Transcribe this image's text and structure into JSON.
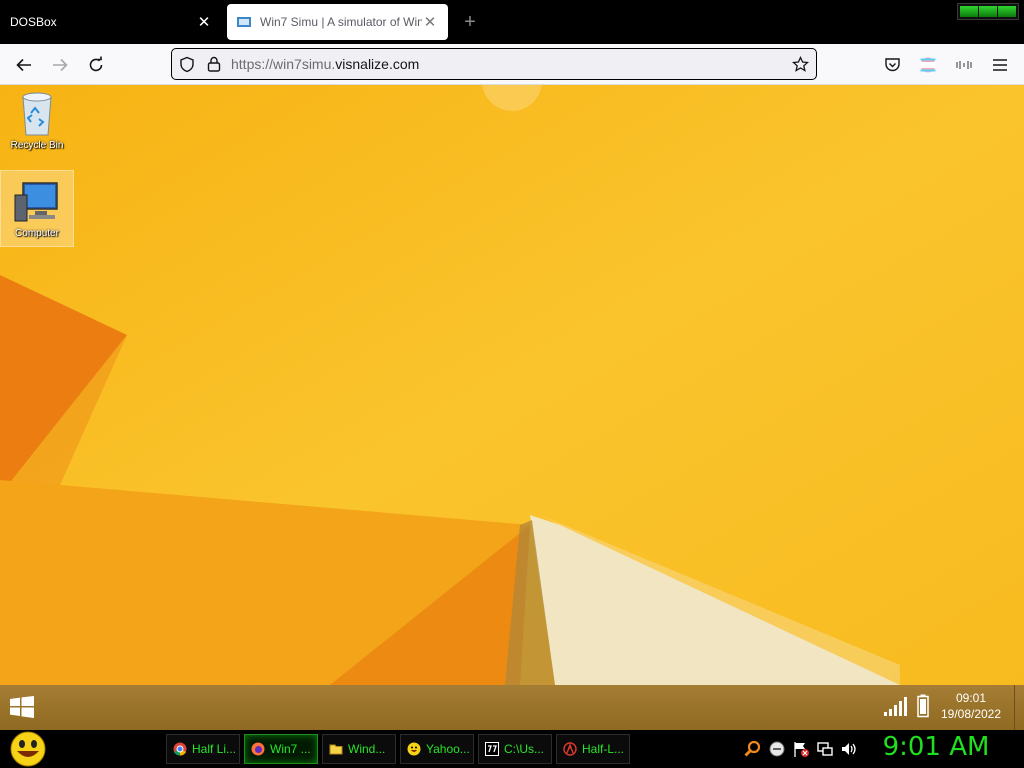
{
  "tabs": [
    {
      "title": "DOSBox",
      "active": false
    },
    {
      "title": "Win7 Simu | A simulator of Win",
      "active": true
    }
  ],
  "navbar": {
    "url_prefix": "https://win7simu.",
    "url_domain": "visnalize.com"
  },
  "desktop": {
    "icons": [
      {
        "label": "Recycle Bin",
        "icon": "recycle-bin-icon",
        "selected": false
      },
      {
        "label": "Computer",
        "icon": "computer-icon",
        "selected": true
      }
    ]
  },
  "w8_taskbar": {
    "time": "09:01",
    "date": "19/08/2022"
  },
  "host_taskbar": {
    "tasks": [
      {
        "label": "Half Li...",
        "icon": "chrome-icon",
        "active": false
      },
      {
        "label": "Win7 ...",
        "icon": "firefox-icon",
        "active": true
      },
      {
        "label": "Wind...",
        "icon": "folder-icon",
        "active": false
      },
      {
        "label": "Yahoo...",
        "icon": "yahoo-messenger-icon",
        "active": false
      },
      {
        "label": "C:\\Us...",
        "icon": "7zip-icon",
        "active": false
      },
      {
        "label": "Half-L...",
        "icon": "half-life-icon",
        "active": false
      }
    ],
    "clock": "9:01 AM"
  },
  "colors": {
    "wallpaper_yellow": "#f8bd22",
    "wallpaper_orange": "#ea7a10",
    "host_green": "#29e429"
  }
}
